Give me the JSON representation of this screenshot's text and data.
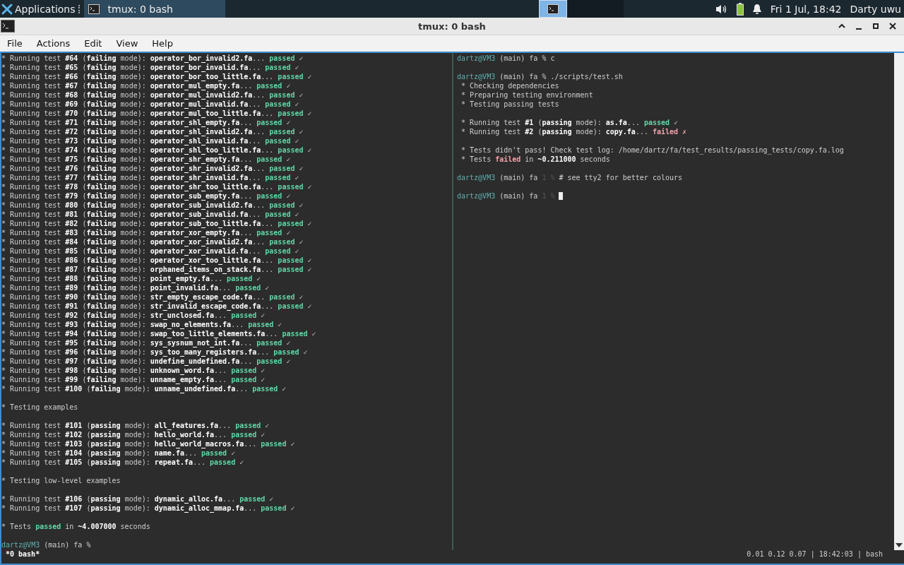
{
  "taskbar": {
    "menu": "Applications",
    "tasks": [
      {
        "label": "tmux: 0 bash",
        "selected": true
      }
    ],
    "workspaces": [
      {
        "selected": true
      },
      {
        "selected": false
      },
      {
        "selected": false
      }
    ],
    "clock": "Fri  1 Jul, 18:42",
    "user": "Darty uwu"
  },
  "window": {
    "title": "tmux: 0 bash"
  },
  "menu": [
    "File",
    "Actions",
    "Edit",
    "View",
    "Help"
  ],
  "panes": [
    {
      "active": false,
      "lines": [
        {
          "kind": "test",
          "text": "* Running test **#64** (**failing** mode): **operator_bor_invalid2.fa**...",
          "result": "passed",
          "failed": false,
          "mark": "✓"
        },
        {
          "kind": "test",
          "text": "* Running test **#65** (**failing** mode): **operator_bor_invalid.fa**...",
          "result": "passed",
          "failed": false,
          "mark": "✓"
        },
        {
          "kind": "test",
          "text": "* Running test **#66** (**failing** mode): **operator_bor_too_little.fa**...",
          "result": "passed",
          "failed": false,
          "mark": "✓"
        },
        {
          "kind": "test",
          "text": "* Running test **#67** (**failing** mode): **operator_mul_empty.fa**...",
          "result": "passed",
          "failed": false,
          "mark": "✓"
        },
        {
          "kind": "test",
          "text": "* Running test **#68** (**failing** mode): **operator_mul_invalid2.fa**...",
          "result": "passed",
          "failed": false,
          "mark": "✓"
        },
        {
          "kind": "test",
          "text": "* Running test **#69** (**failing** mode): **operator_mul_invalid.fa**...",
          "result": "passed",
          "failed": false,
          "mark": "✓"
        },
        {
          "kind": "test",
          "text": "* Running test **#70** (**failing** mode): **operator_mul_too_little.fa**...",
          "result": "passed",
          "failed": false,
          "mark": "✓"
        },
        {
          "kind": "test",
          "text": "* Running test **#71** (**failing** mode): **operator_shl_empty.fa**...",
          "result": "passed",
          "failed": false,
          "mark": "✓"
        },
        {
          "kind": "test",
          "text": "* Running test **#72** (**failing** mode): **operator_shl_invalid2.fa**...",
          "result": "passed",
          "failed": false,
          "mark": "✓"
        },
        {
          "kind": "test",
          "text": "* Running test **#73** (**failing** mode): **operator_shl_invalid.fa**...",
          "result": "passed",
          "failed": false,
          "mark": "✓"
        },
        {
          "kind": "test",
          "text": "* Running test **#74** (**failing** mode): **operator_shl_too_little.fa**...",
          "result": "passed",
          "failed": false,
          "mark": "✓"
        },
        {
          "kind": "test",
          "text": "* Running test **#75** (**failing** mode): **operator_shr_empty.fa**...",
          "result": "passed",
          "failed": false,
          "mark": "✓"
        },
        {
          "kind": "test",
          "text": "* Running test **#76** (**failing** mode): **operator_shr_invalid2.fa**...",
          "result": "passed",
          "failed": false,
          "mark": "✓"
        },
        {
          "kind": "test",
          "text": "* Running test **#77** (**failing** mode): **operator_shr_invalid.fa**...",
          "result": "passed",
          "failed": false,
          "mark": "✓"
        },
        {
          "kind": "test",
          "text": "* Running test **#78** (**failing** mode): **operator_shr_too_little.fa**...",
          "result": "passed",
          "failed": false,
          "mark": "✓"
        },
        {
          "kind": "test",
          "text": "* Running test **#79** (**failing** mode): **operator_sub_empty.fa**...",
          "result": "passed",
          "failed": false,
          "mark": "✓"
        },
        {
          "kind": "test",
          "text": "* Running test **#80** (**failing** mode): **operator_sub_invalid2.fa**...",
          "result": "passed",
          "failed": false,
          "mark": "✓"
        },
        {
          "kind": "test",
          "text": "* Running test **#81** (**failing** mode): **operator_sub_invalid.fa**...",
          "result": "passed",
          "failed": false,
          "mark": "✓"
        },
        {
          "kind": "test",
          "text": "* Running test **#82** (**failing** mode): **operator_sub_too_little.fa**...",
          "result": "passed",
          "failed": false,
          "mark": "✓"
        },
        {
          "kind": "test",
          "text": "* Running test **#83** (**failing** mode): **operator_xor_empty.fa**...",
          "result": "passed",
          "failed": false,
          "mark": "✓"
        },
        {
          "kind": "test",
          "text": "* Running test **#84** (**failing** mode): **operator_xor_invalid2.fa**...",
          "result": "passed",
          "failed": false,
          "mark": "✓"
        },
        {
          "kind": "test",
          "text": "* Running test **#85** (**failing** mode): **operator_xor_invalid.fa**...",
          "result": "passed",
          "failed": false,
          "mark": "✓"
        },
        {
          "kind": "test",
          "text": "* Running test **#86** (**failing** mode): **operator_xor_too_little.fa**...",
          "result": "passed",
          "failed": false,
          "mark": "✓"
        },
        {
          "kind": "test",
          "text": "* Running test **#87** (**failing** mode): **orphaned_items_on_stack.fa**...",
          "result": "passed",
          "failed": false,
          "mark": "✓"
        },
        {
          "kind": "test",
          "text": "* Running test **#88** (**failing** mode): **point_empty.fa**...",
          "result": "passed",
          "failed": false,
          "mark": "✓"
        },
        {
          "kind": "test",
          "text": "* Running test **#89** (**failing** mode): **point_invalid.fa**...",
          "result": "passed",
          "failed": false,
          "mark": "✓"
        },
        {
          "kind": "test",
          "text": "* Running test **#90** (**failing** mode): **str_empty_escape_code.fa**...",
          "result": "passed",
          "failed": false,
          "mark": "✓"
        },
        {
          "kind": "test",
          "text": "* Running test **#91** (**failing** mode): **str_invalid_escape_code.fa**...",
          "result": "passed",
          "failed": false,
          "mark": "✓"
        },
        {
          "kind": "test",
          "text": "* Running test **#92** (**failing** mode): **str_unclosed.fa**...",
          "result": "passed",
          "failed": false,
          "mark": "✓"
        },
        {
          "kind": "test",
          "text": "* Running test **#93** (**failing** mode): **swap_no_elements.fa**...",
          "result": "passed",
          "failed": false,
          "mark": "✓"
        },
        {
          "kind": "test",
          "text": "* Running test **#94** (**failing** mode): **swap_too_little_elements.fa**...",
          "result": "passed",
          "failed": false,
          "mark": "✓"
        },
        {
          "kind": "test",
          "text": "* Running test **#95** (**failing** mode): **sys_sysnum_not_int.fa**...",
          "result": "passed",
          "failed": false,
          "mark": "✓"
        },
        {
          "kind": "test",
          "text": "* Running test **#96** (**failing** mode): **sys_too_many_registers.fa**...",
          "result": "passed",
          "failed": false,
          "mark": "✓"
        },
        {
          "kind": "test",
          "text": "* Running test **#97** (**failing** mode): **undefine_undefined.fa**...",
          "result": "passed",
          "failed": false,
          "mark": "✓"
        },
        {
          "kind": "test",
          "text": "* Running test **#98** (**failing** mode): **unknown_word.fa**...",
          "result": "passed",
          "failed": false,
          "mark": "✓"
        },
        {
          "kind": "test",
          "text": "* Running test **#99** (**failing** mode): **unname_empty.fa**...",
          "result": "passed",
          "failed": false,
          "mark": "✓"
        },
        {
          "kind": "test",
          "text": "* Running test **#100** (**failing** mode): **unname_undefined.fa**...",
          "result": "passed",
          "failed": false,
          "mark": "✓"
        },
        {
          "kind": "blank"
        },
        {
          "kind": "text",
          "text": "* Testing examples"
        },
        {
          "kind": "blank"
        },
        {
          "kind": "test",
          "text": "* Running test **#101** (**passing** mode): **all_features.fa**...",
          "result": "passed",
          "failed": false,
          "mark": "✓"
        },
        {
          "kind": "test",
          "text": "* Running test **#102** (**passing** mode): **hello_world.fa**...",
          "result": "passed",
          "failed": false,
          "mark": "✓"
        },
        {
          "kind": "test",
          "text": "* Running test **#103** (**passing** mode): **hello_world_macros.fa**...",
          "result": "passed",
          "failed": false,
          "mark": "✓"
        },
        {
          "kind": "test",
          "text": "* Running test **#104** (**passing** mode): **name.fa**...",
          "result": "passed",
          "failed": false,
          "mark": "✓"
        },
        {
          "kind": "test",
          "text": "* Running test **#105** (**passing** mode): **repeat.fa**...",
          "result": "passed",
          "failed": false,
          "mark": "✓"
        },
        {
          "kind": "blank"
        },
        {
          "kind": "text",
          "text": "* Testing low-level examples"
        },
        {
          "kind": "blank"
        },
        {
          "kind": "test",
          "text": "* Running test **#106** (**passing** mode): **dynamic_alloc.fa**...",
          "result": "passed",
          "failed": false,
          "mark": "✓"
        },
        {
          "kind": "test",
          "text": "* Running test **#107** (**passing** mode): **dynamic_alloc_mmap.fa**...",
          "result": "passed",
          "failed": false,
          "mark": "✓"
        },
        {
          "kind": "blank"
        },
        {
          "kind": "summary",
          "before": "* Tests",
          "result": "passed",
          "failed": false,
          "after": "in **~4.007000** seconds"
        },
        {
          "kind": "blank"
        },
        {
          "kind": "prompt",
          "user": "dartz@VM3",
          "rest": "(main) fa",
          "sign": "%"
        }
      ]
    },
    {
      "active": true,
      "lines": [
        {
          "kind": "prompt",
          "user": "dartz@VM3",
          "rest": "(main) fa",
          "sign": "%",
          "command": "c"
        },
        {
          "kind": "blank"
        },
        {
          "kind": "prompt",
          "user": "dartz@VM3",
          "rest": "(main) fa",
          "sign": "%",
          "command": "./scripts/test.sh"
        },
        {
          "kind": "text",
          "text": " * Checking dependencies"
        },
        {
          "kind": "text",
          "text": " * Preparing testing environment"
        },
        {
          "kind": "text",
          "text": " * Testing passing tests"
        },
        {
          "kind": "blank"
        },
        {
          "kind": "test",
          "text": " * Running test **#1** (**passing** mode): **as.fa**...",
          "result": "passed",
          "failed": false,
          "mark": "✓"
        },
        {
          "kind": "test",
          "text": " * Running test **#2** (**passing** mode): **copy.fa**...",
          "result": "failed",
          "failed": true,
          "mark": "✗"
        },
        {
          "kind": "blank"
        },
        {
          "kind": "text",
          "text": " * Tests didn't pass! Check test log: /home/dartz/fa/test_results/passing_tests/copy.fa.log"
        },
        {
          "kind": "summary",
          "before": " * Tests",
          "result": "failed",
          "failed": true,
          "after": "in **~0.211000** seconds"
        },
        {
          "kind": "blank"
        },
        {
          "kind": "prompt",
          "user": "dartz@VM3",
          "rest": "(main) fa",
          "code": "1",
          "sign": "%",
          "command": "# see tty2 for better colours"
        },
        {
          "kind": "blank"
        },
        {
          "kind": "prompt",
          "user": "dartz@VM3",
          "rest": "(main) fa",
          "code": "1",
          "sign": "%",
          "cursor": true
        }
      ]
    }
  ],
  "status_bar": {
    "window": "*0 bash*",
    "info": "0.01 0.12 0.07 | 18:42:03 | bash"
  }
}
